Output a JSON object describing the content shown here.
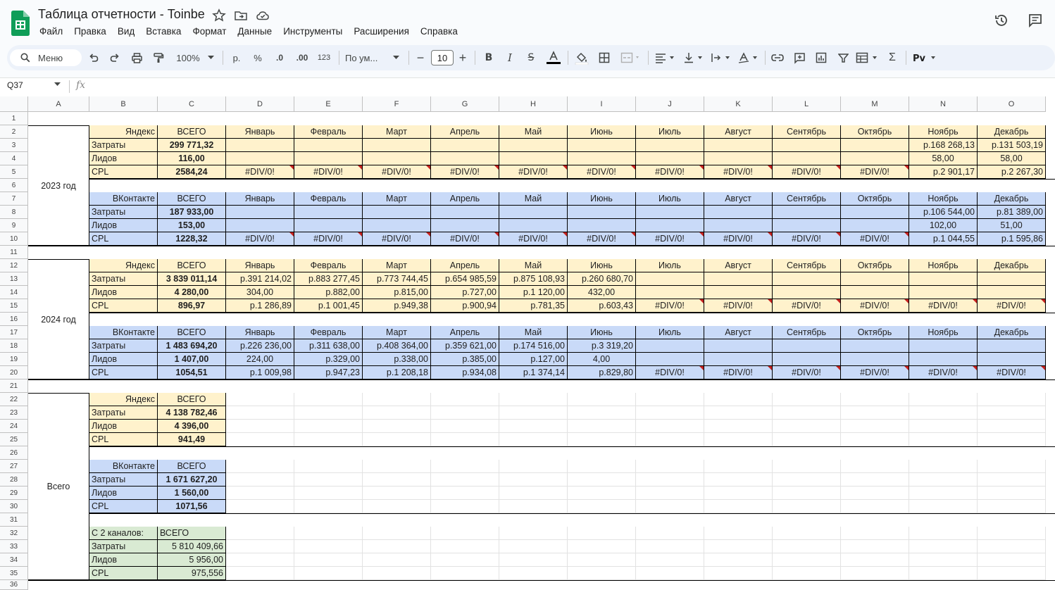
{
  "doc": {
    "title": "Таблица отчетности - Toinbe",
    "menu": [
      "Файл",
      "Правка",
      "Вид",
      "Вставка",
      "Формат",
      "Данные",
      "Инструменты",
      "Расширения",
      "Справка"
    ]
  },
  "toolbar": {
    "search_label": "Меню",
    "zoom": "100%",
    "currency": "р.",
    "percent": "%",
    "dec_less": ".0",
    "dec_more": ".00",
    "number_format": "123",
    "font_name": "По ум...",
    "font_size": "10"
  },
  "formula_bar": {
    "cell_ref": "Q37",
    "fx": "fx",
    "content": ""
  },
  "columns": [
    "A",
    "B",
    "C",
    "D",
    "E",
    "F",
    "G",
    "H",
    "I",
    "J",
    "K",
    "L",
    "M",
    "N",
    "O"
  ],
  "rows": [
    "1",
    "2",
    "3",
    "4",
    "5",
    "6",
    "7",
    "8",
    "9",
    "10",
    "11",
    "12",
    "13",
    "14",
    "15",
    "16",
    "17",
    "18",
    "19",
    "20",
    "21",
    "22",
    "23",
    "24",
    "25",
    "26",
    "27",
    "28",
    "29",
    "30",
    "31",
    "32",
    "33",
    "34",
    "35",
    "36"
  ],
  "months": [
    "Январь",
    "Февраль",
    "Март",
    "Апрель",
    "Май",
    "Июнь",
    "Июль",
    "Август",
    "Сентябрь",
    "Октябрь",
    "Ноябрь",
    "Декабрь"
  ],
  "labels": {
    "total": "ВСЕГО",
    "spend": "Затраты",
    "leads": "Лидов",
    "cpl": "CPL",
    "yandex": "Яндекс",
    "vk": "ВКонтакте",
    "both": "С 2 каналов:"
  },
  "year_labels": {
    "y2023": "2023 год",
    "y2024": "2024 год",
    "all": "Всего"
  },
  "y2023": {
    "yandex": {
      "total_spend": "299 771,32",
      "total_leads": "116,00",
      "total_cpl": "2584,24",
      "spend": [
        "",
        "",
        "",
        "",
        "",
        "",
        "",
        "",
        "",
        "",
        "р.168 268,13",
        "р.131 503,19"
      ],
      "leads": [
        "",
        "",
        "",
        "",
        "",
        "",
        "",
        "",
        "",
        "",
        "58,00",
        "58,00"
      ],
      "cpl": [
        "#DIV/0!",
        "#DIV/0!",
        "#DIV/0!",
        "#DIV/0!",
        "#DIV/0!",
        "#DIV/0!",
        "#DIV/0!",
        "#DIV/0!",
        "#DIV/0!",
        "#DIV/0!",
        "р.2 901,17",
        "р.2 267,30"
      ]
    },
    "vk": {
      "total_spend": "187 933,00",
      "total_leads": "153,00",
      "total_cpl": "1228,32",
      "spend": [
        "",
        "",
        "",
        "",
        "",
        "",
        "",
        "",
        "",
        "",
        "р.106 544,00",
        "р.81 389,00"
      ],
      "leads": [
        "",
        "",
        "",
        "",
        "",
        "",
        "",
        "",
        "",
        "",
        "102,00",
        "51,00"
      ],
      "cpl": [
        "#DIV/0!",
        "#DIV/0!",
        "#DIV/0!",
        "#DIV/0!",
        "#DIV/0!",
        "#DIV/0!",
        "#DIV/0!",
        "#DIV/0!",
        "#DIV/0!",
        "#DIV/0!",
        "р.1 044,55",
        "р.1 595,86"
      ]
    }
  },
  "y2024": {
    "yandex": {
      "total_spend": "3 839 011,14",
      "total_leads": "4 280,00",
      "total_cpl": "896,97",
      "spend": [
        "р.391 214,02",
        "р.883 277,45",
        "р.773 744,45",
        "р.654 985,59",
        "р.875 108,93",
        "р.260 680,70",
        "",
        "",
        "",
        "",
        "",
        ""
      ],
      "leads": [
        "304,00",
        "р.882,00",
        "р.815,00",
        "р.727,00",
        "р.1 120,00",
        "432,00",
        "",
        "",
        "",
        "",
        "",
        ""
      ],
      "cpl": [
        "р.1 286,89",
        "р.1 001,45",
        "р.949,38",
        "р.900,94",
        "р.781,35",
        "р.603,43",
        "#DIV/0!",
        "#DIV/0!",
        "#DIV/0!",
        "#DIV/0!",
        "#DIV/0!",
        "#DIV/0!"
      ]
    },
    "vk": {
      "total_spend": "1 483 694,20",
      "total_leads": "1 407,00",
      "total_cpl": "1054,51",
      "spend": [
        "р.226 236,00",
        "р.311 638,00",
        "р.408 364,00",
        "р.359 621,00",
        "р.174 516,00",
        "р.3 319,20",
        "",
        "",
        "",
        "",
        "",
        ""
      ],
      "leads": [
        "224,00",
        "р.329,00",
        "р.338,00",
        "р.385,00",
        "р.127,00",
        "4,00",
        "",
        "",
        "",
        "",
        "",
        ""
      ],
      "cpl": [
        "р.1 009,98",
        "р.947,23",
        "р.1 208,18",
        "р.934,08",
        "р.1 374,14",
        "р.829,80",
        "#DIV/0!",
        "#DIV/0!",
        "#DIV/0!",
        "#DIV/0!",
        "#DIV/0!",
        "#DIV/0!"
      ]
    }
  },
  "all": {
    "yandex": {
      "total_spend": "4 138 782,46",
      "total_leads": "4 396,00",
      "total_cpl": "941,49"
    },
    "vk": {
      "total_spend": "1 671 627,20",
      "total_leads": "1 560,00",
      "total_cpl": "1071,56"
    },
    "both": {
      "total_spend": "5 810 409,66",
      "total_leads": "5 956,00",
      "total_cpl": "975,556"
    }
  },
  "colors": {
    "yandex_fill": "#fff2cc",
    "vk_fill": "#c9daf8",
    "both_fill": "#d9ead3",
    "error_flag": "#c5221f",
    "sheets_green": "#0f9d58"
  }
}
